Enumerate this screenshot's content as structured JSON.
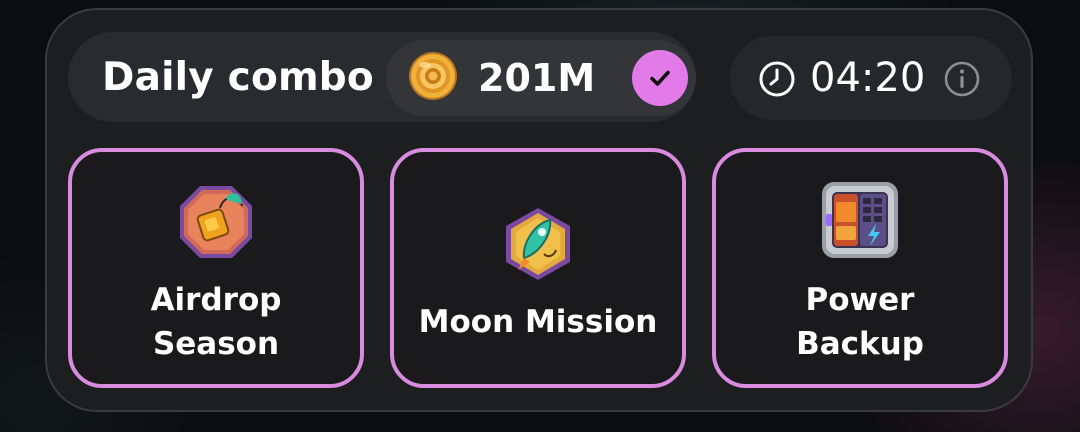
{
  "combo": {
    "title": "Daily combo",
    "reward": "201M",
    "reward_icon": "coin-icon",
    "completed_icon": "checkmark-icon"
  },
  "timer": {
    "value": "04:20",
    "icon": "clock-icon",
    "info_icon": "info-icon"
  },
  "cards": [
    {
      "label": "Airdrop\nSeason",
      "icon": "airdrop-crate-icon"
    },
    {
      "label": "Moon Mission",
      "icon": "rocket-icon"
    },
    {
      "label": "Power\nBackup",
      "icon": "battery-backup-icon"
    }
  ],
  "colors": {
    "accent": "#e27be9",
    "card_border": "#d98be0",
    "panel": "#1d1e20",
    "text": "#ffffff"
  }
}
